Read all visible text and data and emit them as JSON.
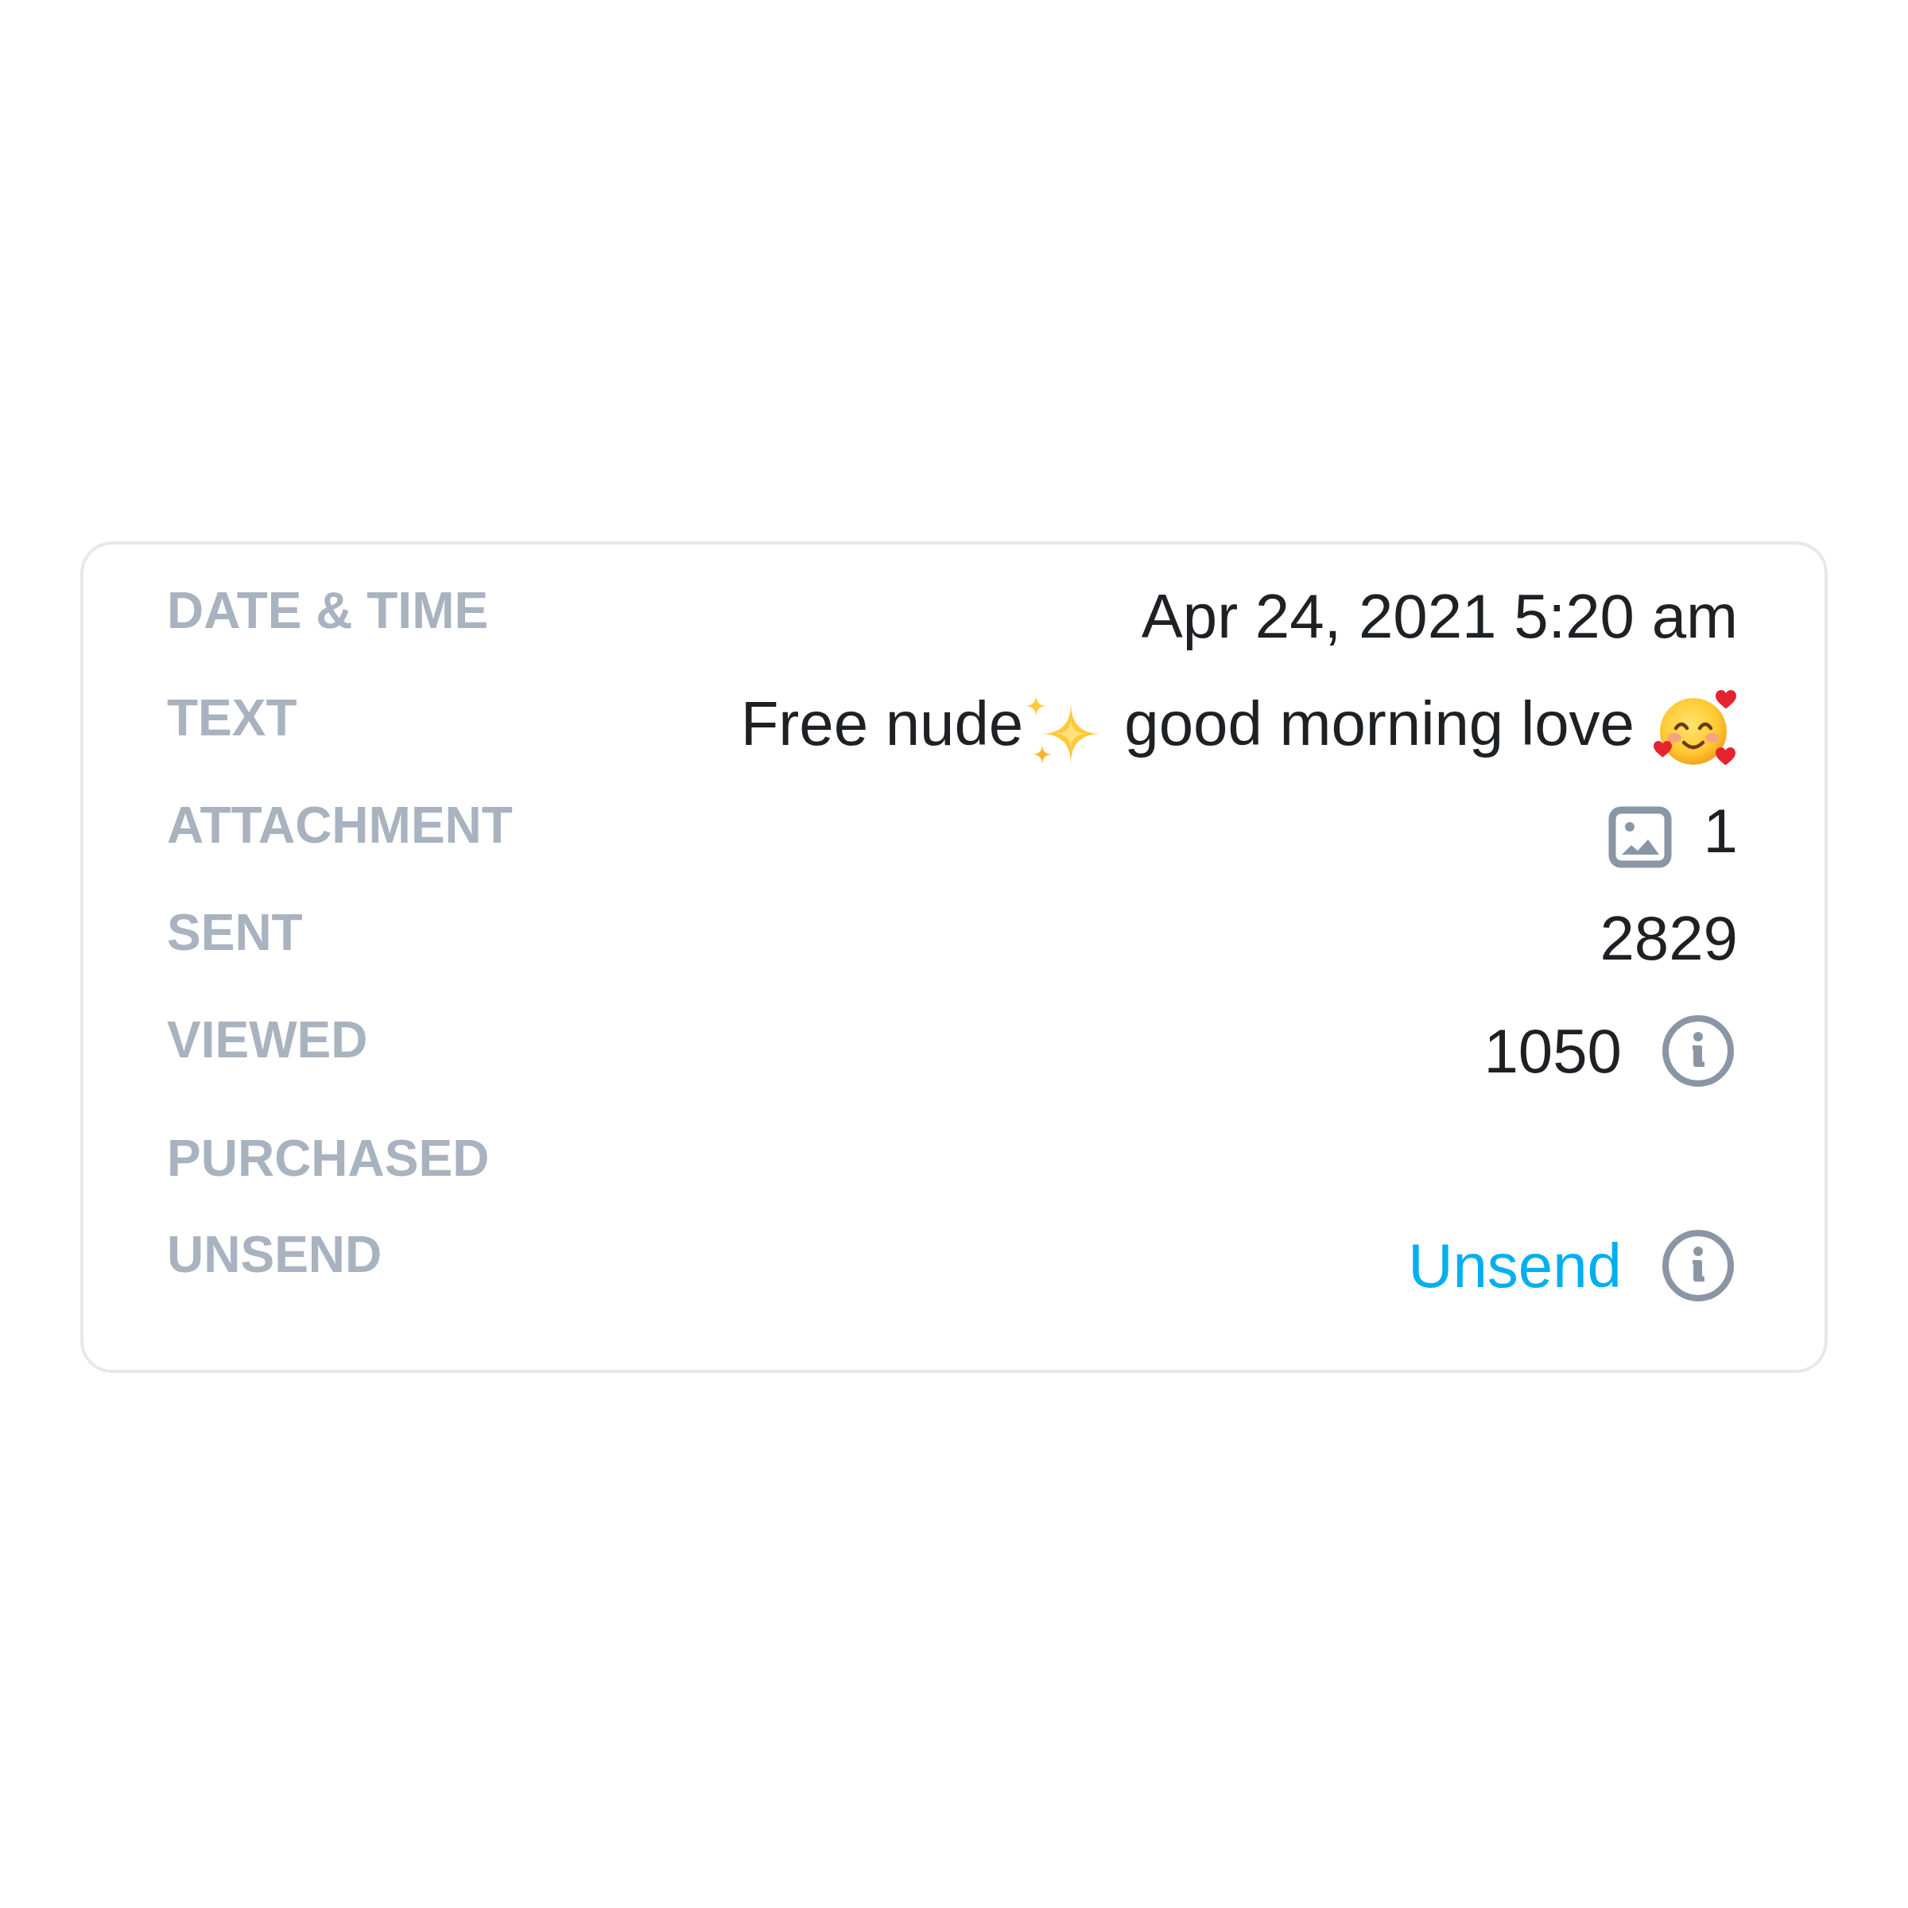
{
  "details": {
    "rows": [
      {
        "kind": "plain",
        "label": "DATE & TIME",
        "value": "Apr 24, 2021 5:20 am",
        "info": false
      },
      {
        "kind": "message",
        "label": "TEXT",
        "parts": [
          "Free nude",
          "good morning love"
        ],
        "info": false
      },
      {
        "kind": "attachment",
        "label": "ATTACHMENT",
        "value": "1",
        "info": false
      },
      {
        "kind": "plain",
        "label": "SENT",
        "value": "2829",
        "info": false
      },
      {
        "kind": "plain",
        "label": "VIEWED",
        "value": "1050",
        "info": true
      },
      {
        "kind": "plain",
        "label": "PURCHASED",
        "info": false
      },
      {
        "kind": "link",
        "label": "UNSEND",
        "value": "Unsend",
        "info": true
      }
    ]
  }
}
